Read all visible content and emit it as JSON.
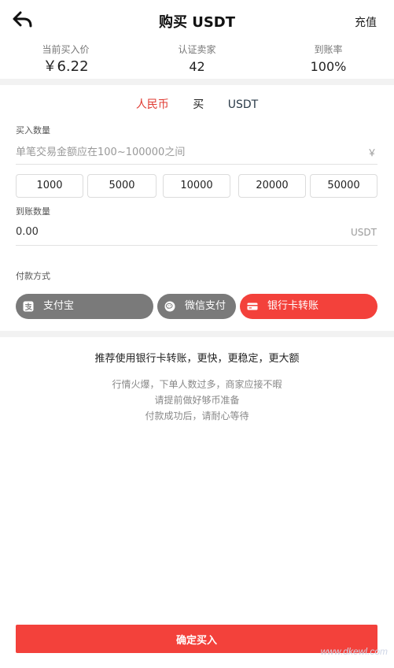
{
  "header": {
    "title": "购买 USDT",
    "action_label": "充值"
  },
  "stats": [
    {
      "label": "当前买入价",
      "value": "￥6.22"
    },
    {
      "label": "认证卖家",
      "value": "42"
    },
    {
      "label": "到账率",
      "value": "100%"
    }
  ],
  "currency_switch": {
    "from": "人民币",
    "action": "买",
    "to": "USDT"
  },
  "buy_amount": {
    "label": "买入数量",
    "placeholder": "单笔交易金额应在100~100000之间",
    "suffix": "￥"
  },
  "quick_amounts": [
    "1000",
    "5000",
    "10000",
    "20000",
    "50000"
  ],
  "received": {
    "label": "到账数量",
    "value": "0.00",
    "suffix": "USDT"
  },
  "payment": {
    "label": "付款方式",
    "methods": [
      {
        "label": "支付宝",
        "icon": "alipay-icon",
        "selected": false
      },
      {
        "label": "微信支付",
        "icon": "wechat-icon",
        "selected": false
      },
      {
        "label": "银行卡转账",
        "icon": "bank-card-icon",
        "selected": true
      }
    ]
  },
  "recommend_text": "推荐使用银行卡转账，更快，更稳定，更大额",
  "notes": [
    "行情火爆，下单人数过多，商家应接不暇",
    "请提前做好够币准备",
    "付款成功后，请耐心等待"
  ],
  "confirm_label": "确定买入",
  "watermark": "www.dkewl.com",
  "colors": {
    "accent_red": "#f3413b",
    "inactive_gray": "#7a7a7a",
    "divider": "#f2f2f2"
  }
}
